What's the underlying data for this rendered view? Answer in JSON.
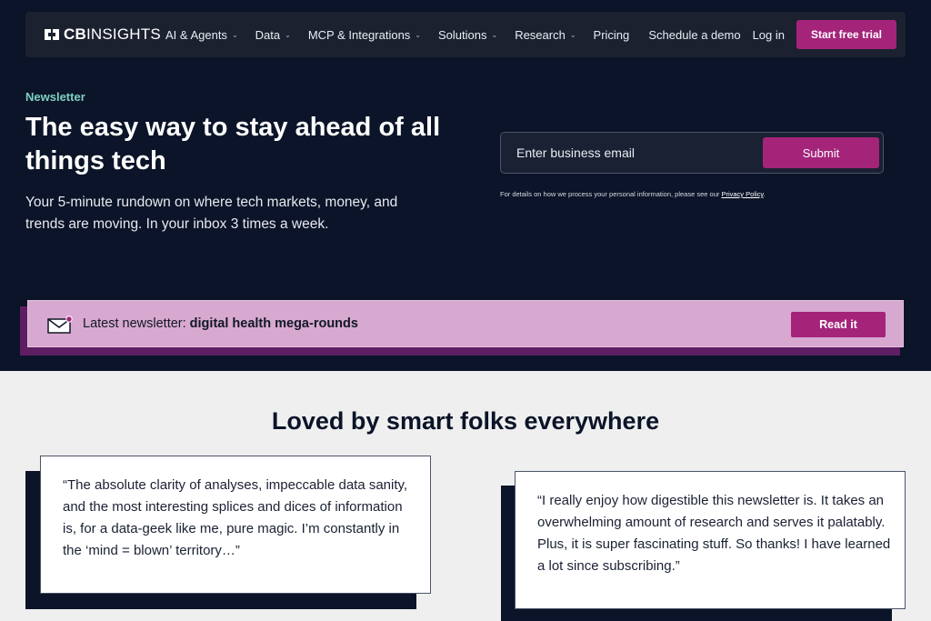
{
  "nav": {
    "logo_bold": "CB",
    "logo_rest": "INSIGHTS",
    "items": [
      {
        "label": "AI & Agents",
        "has_dropdown": true
      },
      {
        "label": "Data",
        "has_dropdown": true
      },
      {
        "label": "MCP & Integrations",
        "has_dropdown": true
      },
      {
        "label": "Solutions",
        "has_dropdown": true
      },
      {
        "label": "Research",
        "has_dropdown": true
      },
      {
        "label": "Pricing",
        "has_dropdown": false
      }
    ],
    "schedule_demo": "Schedule a demo",
    "login": "Log in",
    "start_trial": "Start free trial"
  },
  "hero": {
    "eyebrow": "Newsletter",
    "title": "The easy way to stay ahead of all things tech",
    "subtitle": "Your 5-minute rundown on where tech markets, money, and trends are moving. In your inbox 3 times a week.",
    "email_placeholder": "Enter business email",
    "submit_label": "Submit",
    "privacy_prefix": "For details on how we process your personal information, please see our ",
    "privacy_link": "Privacy Policy",
    "privacy_suffix": "."
  },
  "banner": {
    "prefix": "Latest newsletter: ",
    "topic": "digital health mega-rounds",
    "read_label": "Read it"
  },
  "testimonials": {
    "title": "Loved by smart folks everywhere",
    "quotes": [
      "“The absolute clarity of analyses, impeccable data sanity, and the most interesting splices and dices of information is, for a data-geek like me, pure magic. I’m constantly in the ‘mind = blown’ territory…”",
      "“I really enjoy how digestible this newsletter is. It takes an overwhelming amount of research and serves it palatably. Plus, it is super fascinating stuff. So thanks! I have learned a lot since subscribing.”"
    ]
  },
  "colors": {
    "background": "#0b1428",
    "nav_bg": "#1c2130",
    "accent": "#a4247a",
    "eyebrow": "#7fcfc3",
    "banner_bg": "#d8a9d0",
    "banner_shadow": "#5e1e63",
    "section_bg": "#efefef"
  }
}
